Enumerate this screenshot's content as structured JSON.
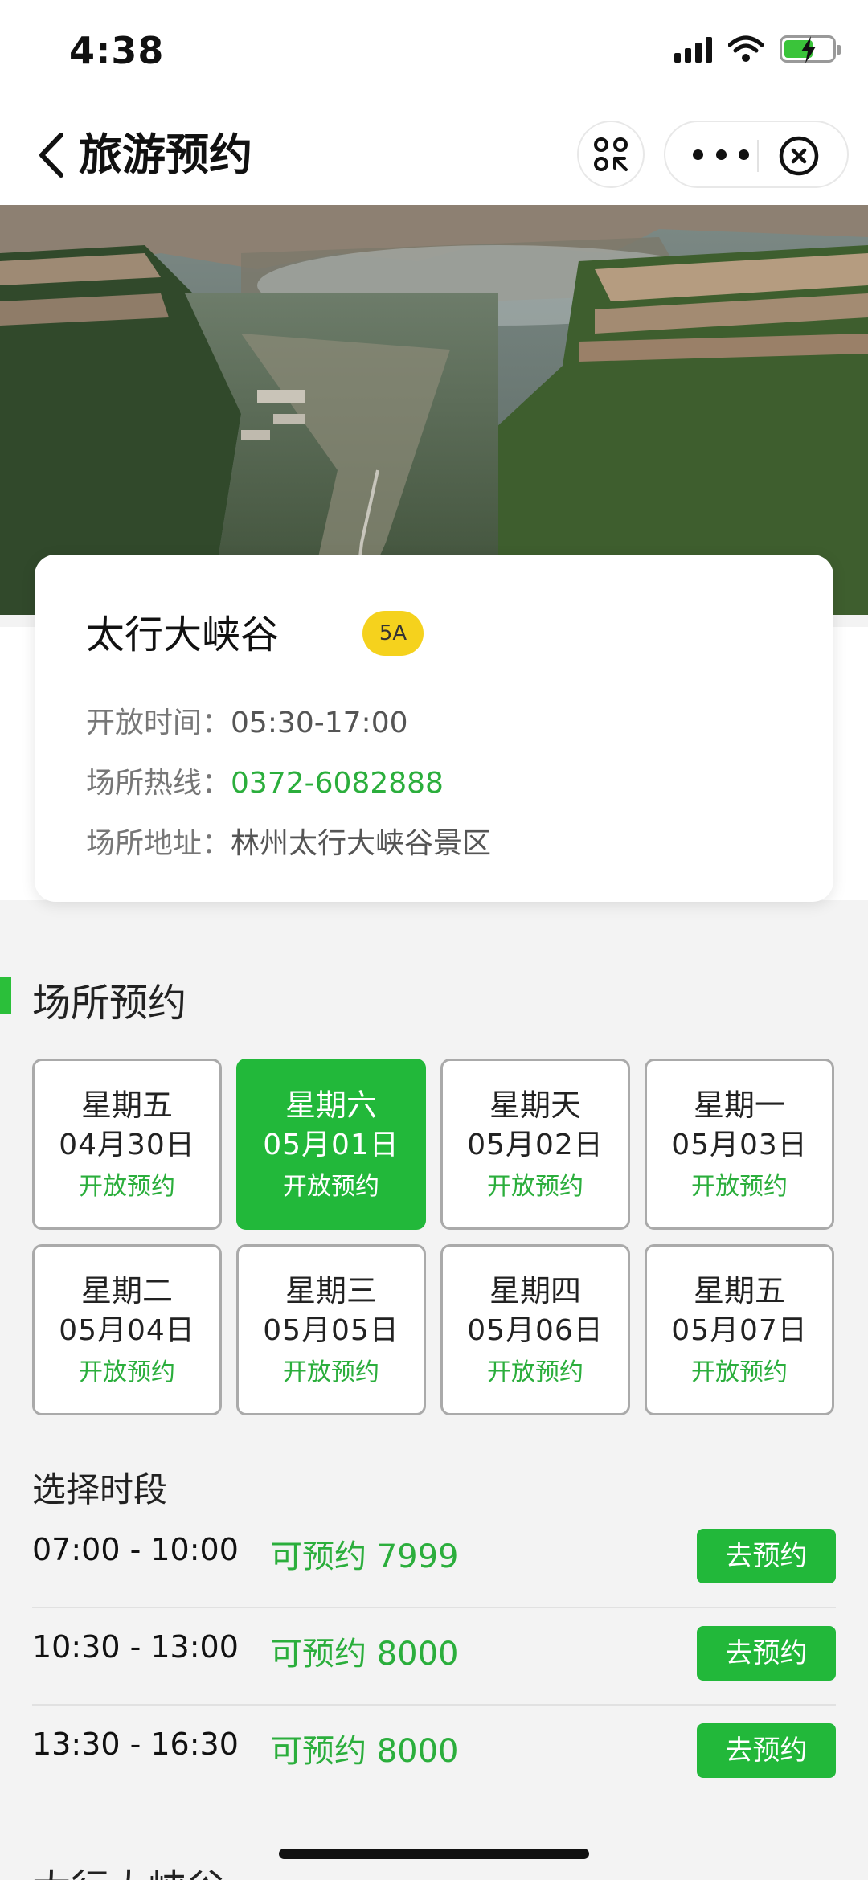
{
  "status_bar": {
    "time": "4:38"
  },
  "nav": {
    "title": "旅游预约"
  },
  "info": {
    "name": "太行大峡谷",
    "level": "5A",
    "open_label": "开放时间：",
    "open_value": "05:30-17:00",
    "hotline_label": "场所热线：",
    "hotline_value": "0372-6082888",
    "address_label": "场所地址：",
    "address_value": "林州太行大峡谷景区"
  },
  "booking": {
    "section_title": "场所预约",
    "dates": [
      {
        "weekday": "星期五",
        "date": "04月30日",
        "status": "开放预约",
        "selected": false
      },
      {
        "weekday": "星期六",
        "date": "05月01日",
        "status": "开放预约",
        "selected": true
      },
      {
        "weekday": "星期天",
        "date": "05月02日",
        "status": "开放预约",
        "selected": false
      },
      {
        "weekday": "星期一",
        "date": "05月03日",
        "status": "开放预约",
        "selected": false
      },
      {
        "weekday": "星期二",
        "date": "05月04日",
        "status": "开放预约",
        "selected": false
      },
      {
        "weekday": "星期三",
        "date": "05月05日",
        "status": "开放预约",
        "selected": false
      },
      {
        "weekday": "星期四",
        "date": "05月06日",
        "status": "开放预约",
        "selected": false
      },
      {
        "weekday": "星期五",
        "date": "05月07日",
        "status": "开放预约",
        "selected": false
      }
    ],
    "slot_title": "选择时段",
    "slots": [
      {
        "time": "07:00 - 10:00",
        "avail": "可预约 7999",
        "button": "去预约"
      },
      {
        "time": "10:30 - 13:00",
        "avail": "可预约 8000",
        "button": "去预约"
      },
      {
        "time": "13:30 - 16:30",
        "avail": "可预约 8000",
        "button": "去预约"
      }
    ]
  },
  "next_section": {
    "title": "太行大峡谷"
  },
  "colors": {
    "accent": "#22b83a",
    "badge": "#f5d21d",
    "green_text": "#2bae3c"
  }
}
